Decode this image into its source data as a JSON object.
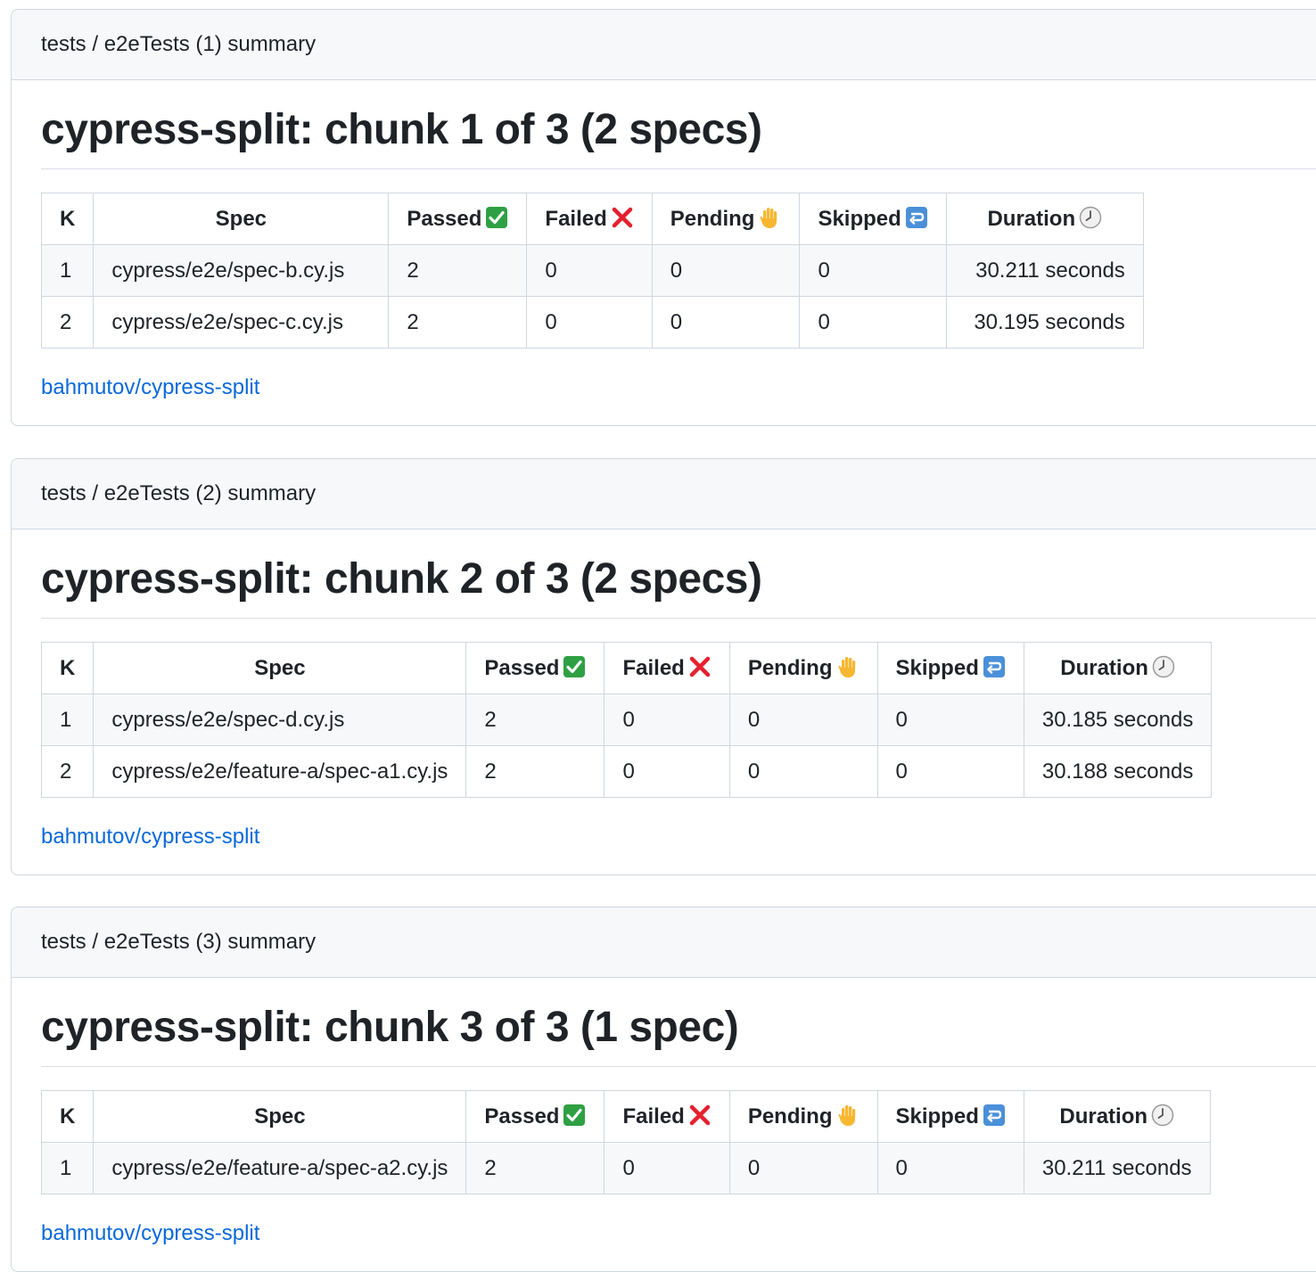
{
  "colors": {
    "link": "#0969da",
    "header_bg": "#f6f8fa",
    "border": "#d0d7de",
    "passed_icon": "#2ea043",
    "failed_icon": "#e5202e",
    "skipped_icon": "#4a90d9"
  },
  "icons": {
    "passed": "check-mark-button-icon",
    "failed": "cross-mark-icon",
    "pending": "raised-hand-icon",
    "skipped": "return-arrow-icon",
    "duration": "clock-icon"
  },
  "columns": {
    "k": "K",
    "spec": "Spec",
    "passed": "Passed",
    "failed": "Failed",
    "pending": "Pending",
    "skipped": "Skipped",
    "duration": "Duration"
  },
  "summaries": [
    {
      "header": "tests / e2eTests (1) summary",
      "title": "cypress-split: chunk 1 of 3 (2 specs)",
      "link": "bahmutov/cypress-split",
      "rows": [
        {
          "k": "1",
          "spec": "cypress/e2e/spec-b.cy.js",
          "passed": "2",
          "failed": "0",
          "pending": "0",
          "skipped": "0",
          "duration": "30.211 seconds"
        },
        {
          "k": "2",
          "spec": "cypress/e2e/spec-c.cy.js",
          "passed": "2",
          "failed": "0",
          "pending": "0",
          "skipped": "0",
          "duration": "30.195 seconds"
        }
      ]
    },
    {
      "header": "tests / e2eTests (2) summary",
      "title": "cypress-split: chunk 2 of 3 (2 specs)",
      "link": "bahmutov/cypress-split",
      "rows": [
        {
          "k": "1",
          "spec": "cypress/e2e/spec-d.cy.js",
          "passed": "2",
          "failed": "0",
          "pending": "0",
          "skipped": "0",
          "duration": "30.185 seconds"
        },
        {
          "k": "2",
          "spec": "cypress/e2e/feature-a/spec-a1.cy.js",
          "passed": "2",
          "failed": "0",
          "pending": "0",
          "skipped": "0",
          "duration": "30.188 seconds"
        }
      ]
    },
    {
      "header": "tests / e2eTests (3) summary",
      "title": "cypress-split: chunk 3 of 3 (1 spec)",
      "link": "bahmutov/cypress-split",
      "rows": [
        {
          "k": "1",
          "spec": "cypress/e2e/feature-a/spec-a2.cy.js",
          "passed": "2",
          "failed": "0",
          "pending": "0",
          "skipped": "0",
          "duration": "30.211 seconds"
        }
      ]
    }
  ]
}
